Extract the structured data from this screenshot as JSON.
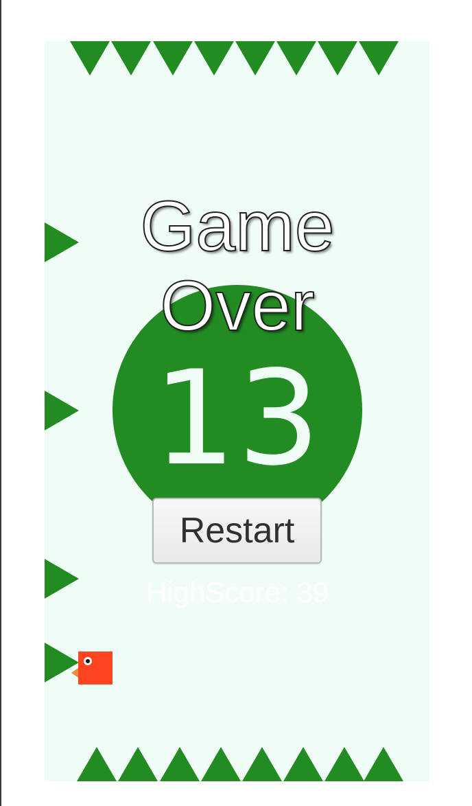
{
  "game": {
    "title": "Game\nOver",
    "score": "13",
    "restart_label": "Restart",
    "highscore_text": "HighScore: 39"
  },
  "colors": {
    "spike": "#228b22",
    "background": "#f0fdf7",
    "score_circle": "#228b22",
    "bird": "#ff4422"
  },
  "icons": {
    "player": "red-square-bird-icon",
    "hazard": "green-triangle-spike-icon"
  }
}
